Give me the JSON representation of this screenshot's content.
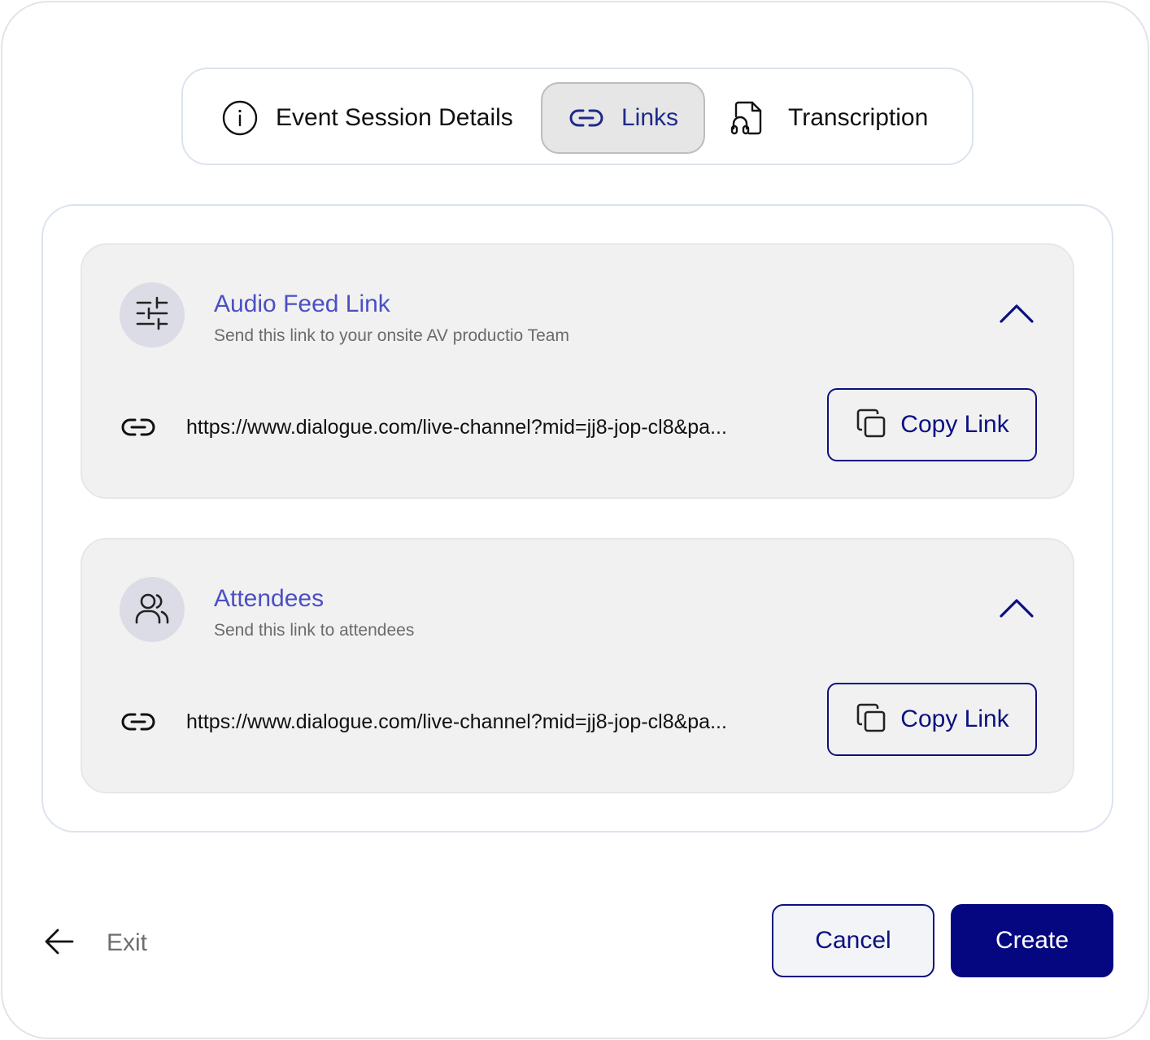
{
  "tabs": [
    {
      "label": "Event Session Details",
      "icon": "info-icon",
      "active": false
    },
    {
      "label": "Links",
      "icon": "link-icon",
      "active": true
    },
    {
      "label": "Transcription",
      "icon": "audio-file-icon",
      "active": false
    }
  ],
  "cards": [
    {
      "title": "Audio Feed Link",
      "subtitle": "Send this link to your onsite AV productio Team",
      "icon": "sliders-icon",
      "url": "https://www.dialogue.com/live-channel?mid=jj8-jop-cl8&pa...",
      "copy_label": "Copy Link",
      "expanded": true
    },
    {
      "title": "Attendees",
      "subtitle": "Send this link to attendees",
      "icon": "users-icon",
      "url": "https://www.dialogue.com/live-channel?mid=jj8-jop-cl8&pa...",
      "copy_label": "Copy Link",
      "expanded": true
    }
  ],
  "footer": {
    "exit_label": "Exit",
    "cancel_label": "Cancel",
    "create_label": "Create"
  },
  "colors": {
    "accent": "#04077f",
    "title": "#4b4fc4",
    "card_bg": "#f1f1f1",
    "active_tab_bg": "#e6e6e6"
  }
}
